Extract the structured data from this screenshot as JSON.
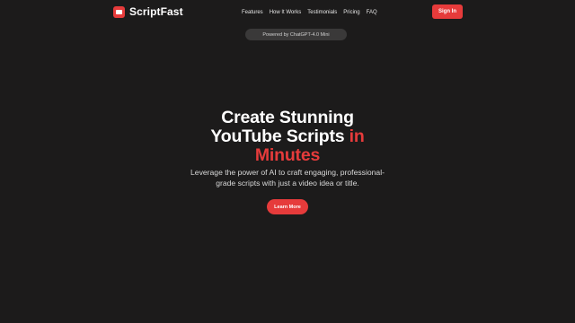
{
  "brand": {
    "name": "ScriptFast",
    "icon": "film-icon",
    "color": "#e63b3b"
  },
  "nav": {
    "items": [
      "Features",
      "How It Works",
      "Testimonials",
      "Pricing",
      "FAQ"
    ],
    "signin_label": "Sign In"
  },
  "pill": {
    "text": "Powered by ChatGPT-4.0 Mini"
  },
  "hero": {
    "title_line1": "Create Stunning",
    "title_line2_main": "YouTube Scripts",
    "title_line2_accent": "in",
    "title_line3_accent": "Minutes",
    "subtitle_line1": "Leverage the power of AI to craft engaging, professional-",
    "subtitle_line2": "grade scripts with just a video idea or title.",
    "cta_label": "Learn More"
  },
  "colors": {
    "background": "#1c1b1b",
    "accent": "#e63b3b",
    "pill_bg": "#3a3939"
  }
}
